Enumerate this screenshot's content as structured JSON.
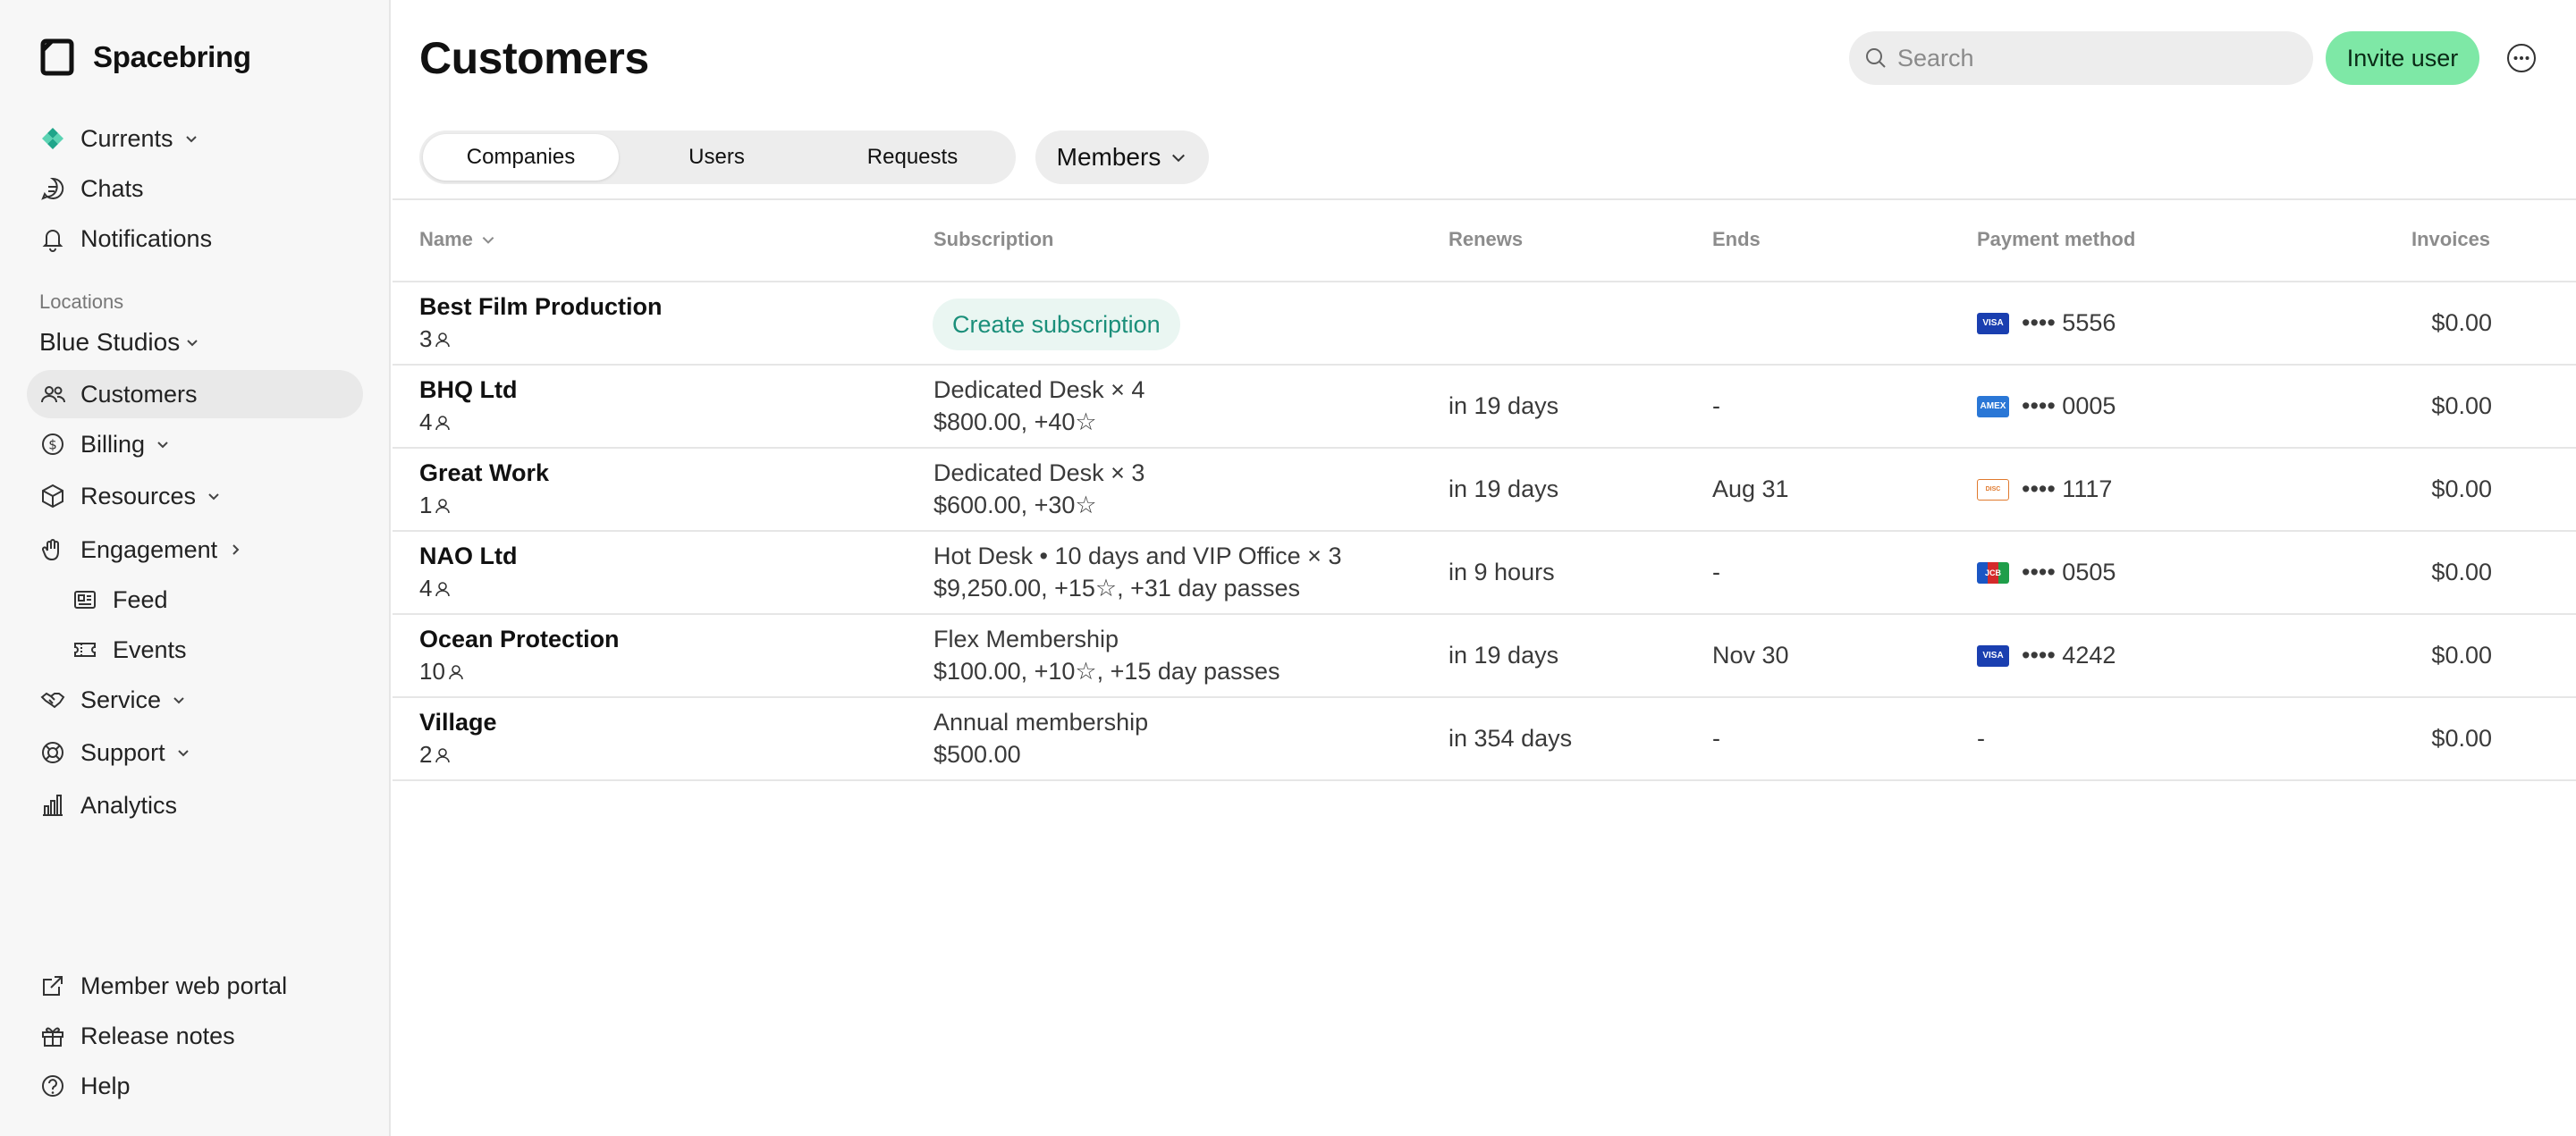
{
  "brand": {
    "name": "Spacebring"
  },
  "sidebar": {
    "top_items": [
      {
        "label": "Currents"
      },
      {
        "label": "Chats"
      },
      {
        "label": "Notifications"
      }
    ],
    "section_label": "Locations",
    "location": "Blue Studios",
    "location_items": [
      {
        "label": "Customers"
      },
      {
        "label": "Billing"
      },
      {
        "label": "Resources"
      },
      {
        "label": "Engagement"
      },
      {
        "label": "Feed"
      },
      {
        "label": "Events"
      },
      {
        "label": "Service"
      },
      {
        "label": "Support"
      },
      {
        "label": "Analytics"
      }
    ],
    "bottom_items": [
      {
        "label": "Member web portal"
      },
      {
        "label": "Release notes"
      },
      {
        "label": "Help"
      }
    ]
  },
  "header": {
    "title": "Customers",
    "search_placeholder": "Search",
    "invite_label": "Invite user"
  },
  "tabs": [
    {
      "label": "Companies"
    },
    {
      "label": "Users"
    },
    {
      "label": "Requests"
    }
  ],
  "members_label": "Members",
  "table": {
    "columns": {
      "name": "Name",
      "subscription": "Subscription",
      "renews": "Renews",
      "ends": "Ends",
      "payment": "Payment method",
      "invoices": "Invoices"
    },
    "rows": [
      {
        "name": "Best Film Production",
        "count": "3",
        "sub_line1": "",
        "sub_line2": "",
        "create_label": "Create subscription",
        "renews": "",
        "ends": "",
        "card": "•••• 5556",
        "card_brand": "visa",
        "invoices": "$0.00"
      },
      {
        "name": "BHQ Ltd",
        "count": "4",
        "sub_line1": "Dedicated Desk × 4",
        "sub_line2": "$800.00, +40☆",
        "renews": "in 19 days",
        "ends": "-",
        "card": "•••• 0005",
        "card_brand": "amex",
        "invoices": "$0.00"
      },
      {
        "name": "Great Work",
        "count": "1",
        "sub_line1": "Dedicated Desk × 3",
        "sub_line2": "$600.00, +30☆",
        "renews": "in 19 days",
        "ends": "Aug 31",
        "card": "•••• 1117",
        "card_brand": "discover",
        "invoices": "$0.00"
      },
      {
        "name": "NAO Ltd",
        "count": "4",
        "sub_line1": "Hot Desk • 10 days and VIP Office × 3",
        "sub_line2": "$9,250.00, +15☆, +31 day passes",
        "renews": "in 9 hours",
        "ends": "-",
        "card": "•••• 0505",
        "card_brand": "jcb",
        "invoices": "$0.00"
      },
      {
        "name": "Ocean Protection",
        "count": "10",
        "sub_line1": "Flex Membership",
        "sub_line2": "$100.00, +10☆, +15 day passes",
        "renews": "in 19 days",
        "ends": "Nov 30",
        "card": "•••• 4242",
        "card_brand": "visa",
        "invoices": "$0.00"
      },
      {
        "name": "Village",
        "count": "2",
        "sub_line1": "Annual membership",
        "sub_line2": "$500.00",
        "renews": "in 354 days",
        "ends": "-",
        "card": "-",
        "card_brand": "",
        "invoices": "$0.00"
      }
    ]
  },
  "colors": {
    "accent": "#7ee8a6",
    "teal": "#1b8f7a",
    "visa": "#1a3fb0",
    "amex": "#2a77d6"
  }
}
